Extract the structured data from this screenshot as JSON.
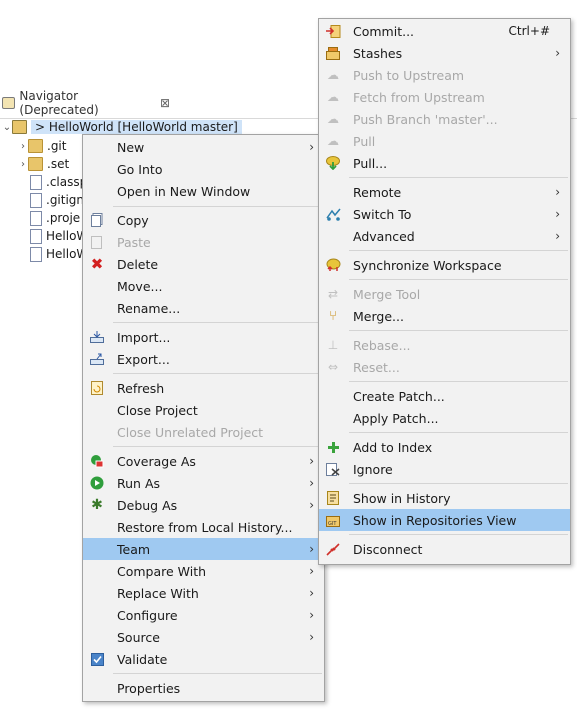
{
  "navigator": {
    "tab_title": "Navigator (Deprecated)",
    "close_glyph": "⊠",
    "project_label": "> HelloWorld [HelloWorld master]",
    "tree_items": [
      ".git",
      ".set",
      ".classp",
      ".gitign",
      ".proje",
      "HelloW",
      "HelloW"
    ]
  },
  "context_menu": {
    "items": [
      {
        "label": "New",
        "submenu": true
      },
      {
        "label": "Go Into"
      },
      {
        "label": "Open in New Window"
      },
      {
        "label": "Copy",
        "icon": "copy-icon"
      },
      {
        "label": "Paste",
        "icon": "paste-icon",
        "disabled": true
      },
      {
        "label": "Delete",
        "icon": "delete-icon"
      },
      {
        "label": "Move..."
      },
      {
        "label": "Rename..."
      },
      {
        "label": "Import...",
        "icon": "import-icon"
      },
      {
        "label": "Export...",
        "icon": "export-icon"
      },
      {
        "label": "Refresh",
        "icon": "refresh-icon"
      },
      {
        "label": "Close Project"
      },
      {
        "label": "Close Unrelated Project",
        "disabled": true
      },
      {
        "label": "Coverage As",
        "icon": "coverage-icon",
        "submenu": true
      },
      {
        "label": "Run As",
        "icon": "run-icon",
        "submenu": true
      },
      {
        "label": "Debug As",
        "icon": "debug-icon",
        "submenu": true
      },
      {
        "label": "Restore from Local History..."
      },
      {
        "label": "Team",
        "submenu": true,
        "highlighted": true
      },
      {
        "label": "Compare With",
        "submenu": true
      },
      {
        "label": "Replace With",
        "submenu": true
      },
      {
        "label": "Configure",
        "submenu": true
      },
      {
        "label": "Source",
        "submenu": true
      },
      {
        "label": "Validate",
        "icon": "checkbox-checked-icon"
      },
      {
        "label": "Properties"
      }
    ]
  },
  "team_menu": {
    "items": [
      {
        "label": "Commit...",
        "icon": "commit-icon",
        "accel": "Ctrl+#"
      },
      {
        "label": "Stashes",
        "icon": "stash-icon",
        "submenu": true
      },
      {
        "label": "Push to Upstream",
        "icon": "push-icon",
        "disabled": true
      },
      {
        "label": "Fetch from Upstream",
        "icon": "fetch-icon",
        "disabled": true
      },
      {
        "label": "Push Branch 'master'...",
        "icon": "push-branch-icon",
        "disabled": true
      },
      {
        "label": "Pull",
        "icon": "pull-icon",
        "disabled": true
      },
      {
        "label": "Pull...",
        "icon": "pull-dialog-icon"
      },
      {
        "label": "Remote",
        "submenu": true
      },
      {
        "label": "Switch To",
        "icon": "switch-branch-icon",
        "submenu": true
      },
      {
        "label": "Advanced",
        "submenu": true
      },
      {
        "label": "Synchronize Workspace",
        "icon": "synchronize-icon"
      },
      {
        "label": "Merge Tool",
        "icon": "merge-tool-icon",
        "disabled": true
      },
      {
        "label": "Merge...",
        "icon": "merge-icon"
      },
      {
        "label": "Rebase...",
        "icon": "rebase-icon",
        "disabled": true
      },
      {
        "label": "Reset...",
        "icon": "reset-icon",
        "disabled": true
      },
      {
        "label": "Create Patch..."
      },
      {
        "label": "Apply Patch..."
      },
      {
        "label": "Add to Index",
        "icon": "add-icon"
      },
      {
        "label": "Ignore",
        "icon": "ignore-icon"
      },
      {
        "label": "Show in History",
        "icon": "history-icon"
      },
      {
        "label": "Show in Repositories View",
        "icon": "repositories-icon",
        "highlighted": true
      },
      {
        "label": "Disconnect",
        "icon": "disconnect-icon"
      }
    ]
  }
}
